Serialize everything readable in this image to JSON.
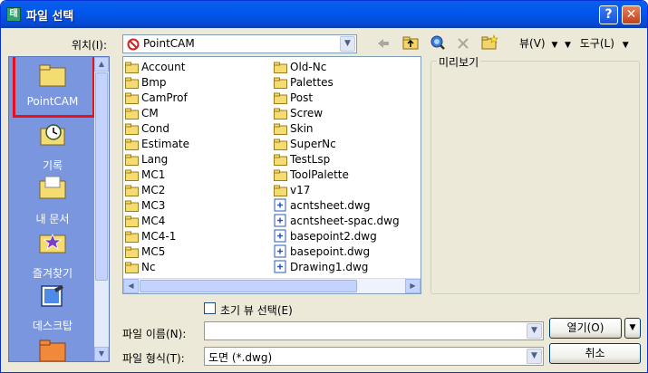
{
  "window": {
    "title": "파일 선택",
    "app_icon_glyph": "태"
  },
  "lookin": {
    "label": "위치(I):",
    "value": "PointCAM"
  },
  "toolbar": {
    "view_label": "뷰(V)",
    "tools_label": "도구(L)"
  },
  "places": [
    {
      "label": "PointCAM",
      "icon": "folder-icon",
      "selected": true
    },
    {
      "label": "기록",
      "icon": "history-icon",
      "selected": false
    },
    {
      "label": "내 문서",
      "icon": "my-documents-icon",
      "selected": false
    },
    {
      "label": "즐겨찾기",
      "icon": "favorites-icon",
      "selected": false
    },
    {
      "label": "데스크탑",
      "icon": "desktop-icon",
      "selected": false
    }
  ],
  "files": {
    "col1": [
      {
        "name": "Account",
        "type": "folder"
      },
      {
        "name": "Bmp",
        "type": "folder"
      },
      {
        "name": "CamProf",
        "type": "folder"
      },
      {
        "name": "CM",
        "type": "folder"
      },
      {
        "name": "Cond",
        "type": "folder"
      },
      {
        "name": "Estimate",
        "type": "folder"
      },
      {
        "name": "Lang",
        "type": "folder"
      },
      {
        "name": "MC1",
        "type": "folder"
      },
      {
        "name": "MC2",
        "type": "folder"
      },
      {
        "name": "MC3",
        "type": "folder"
      },
      {
        "name": "MC4",
        "type": "folder"
      },
      {
        "name": "MC4-1",
        "type": "folder"
      },
      {
        "name": "MC5",
        "type": "folder"
      },
      {
        "name": "Nc",
        "type": "folder"
      }
    ],
    "col2": [
      {
        "name": "Old-Nc",
        "type": "folder"
      },
      {
        "name": "Palettes",
        "type": "folder"
      },
      {
        "name": "Post",
        "type": "folder"
      },
      {
        "name": "Screw",
        "type": "folder"
      },
      {
        "name": "Skin",
        "type": "folder"
      },
      {
        "name": "SuperNc",
        "type": "folder"
      },
      {
        "name": "TestLsp",
        "type": "folder"
      },
      {
        "name": "ToolPalette",
        "type": "folder"
      },
      {
        "name": "v17",
        "type": "folder"
      },
      {
        "name": "acntsheet.dwg",
        "type": "dwg"
      },
      {
        "name": "acntsheet-spac.dwg",
        "type": "dwg"
      },
      {
        "name": "basepoint2.dwg",
        "type": "dwg"
      },
      {
        "name": "basepoint.dwg",
        "type": "dwg"
      },
      {
        "name": "Drawing1.dwg",
        "type": "dwg"
      }
    ]
  },
  "preview": {
    "label": "미리보기"
  },
  "initial_view": {
    "label": "초기 뷰 선택(E)"
  },
  "filename": {
    "label": "파일 이름(N):",
    "value": ""
  },
  "filetype": {
    "label": "파일 형식(T):",
    "value": "도면 (*.dwg)"
  },
  "buttons": {
    "open": "열기(O)",
    "cancel": "취소"
  }
}
